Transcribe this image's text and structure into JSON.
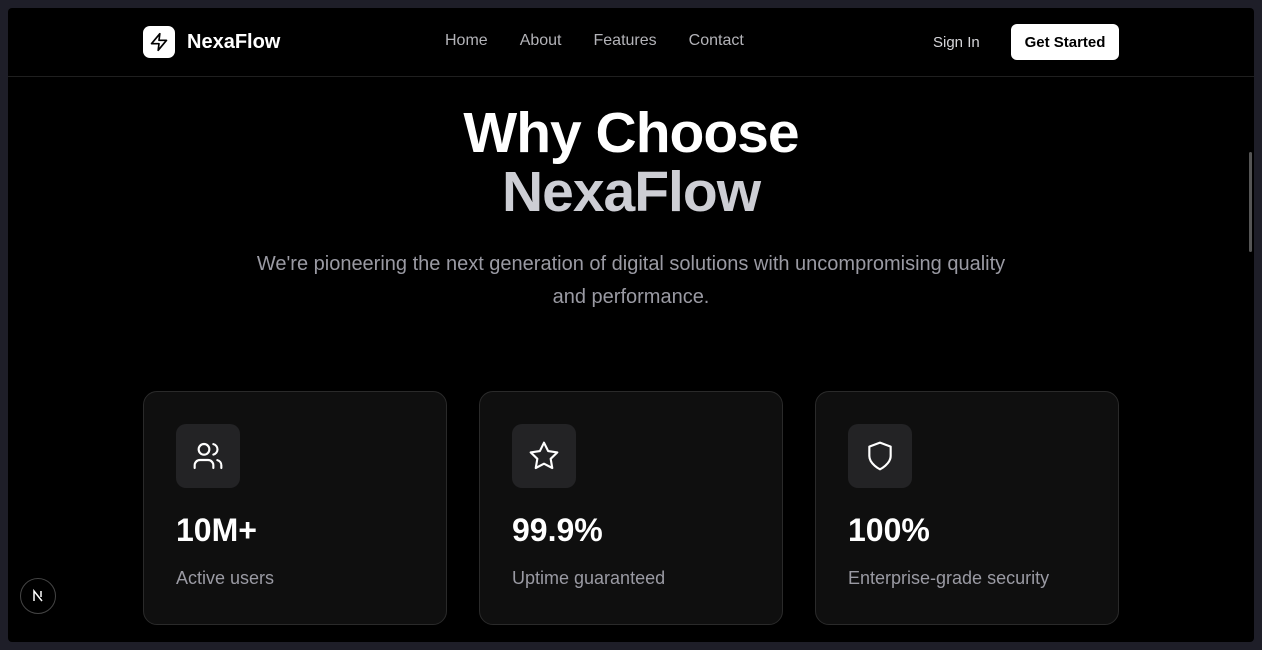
{
  "brand": {
    "name": "NexaFlow",
    "icon": "lightning-bolt-icon"
  },
  "nav": {
    "links": [
      "Home",
      "About",
      "Features",
      "Contact"
    ],
    "sign_in": "Sign In",
    "cta": "Get Started"
  },
  "hero": {
    "title_line1": "Why Choose",
    "title_line2": "NexaFlow",
    "subtitle": "We're pioneering the next generation of digital solutions with uncompromising quality and performance."
  },
  "stats": [
    {
      "icon": "users-icon",
      "value": "10M+",
      "label": "Active users"
    },
    {
      "icon": "star-icon",
      "value": "99.9%",
      "label": "Uptime guaranteed"
    },
    {
      "icon": "shield-icon",
      "value": "100%",
      "label": "Enterprise-grade security"
    }
  ],
  "badge": {
    "text": "N",
    "icon": "nextjs-icon"
  },
  "colors": {
    "background": "#000000",
    "card": "#0f0f0f",
    "accent": "#ffffff",
    "muted": "#9a9aa3"
  }
}
